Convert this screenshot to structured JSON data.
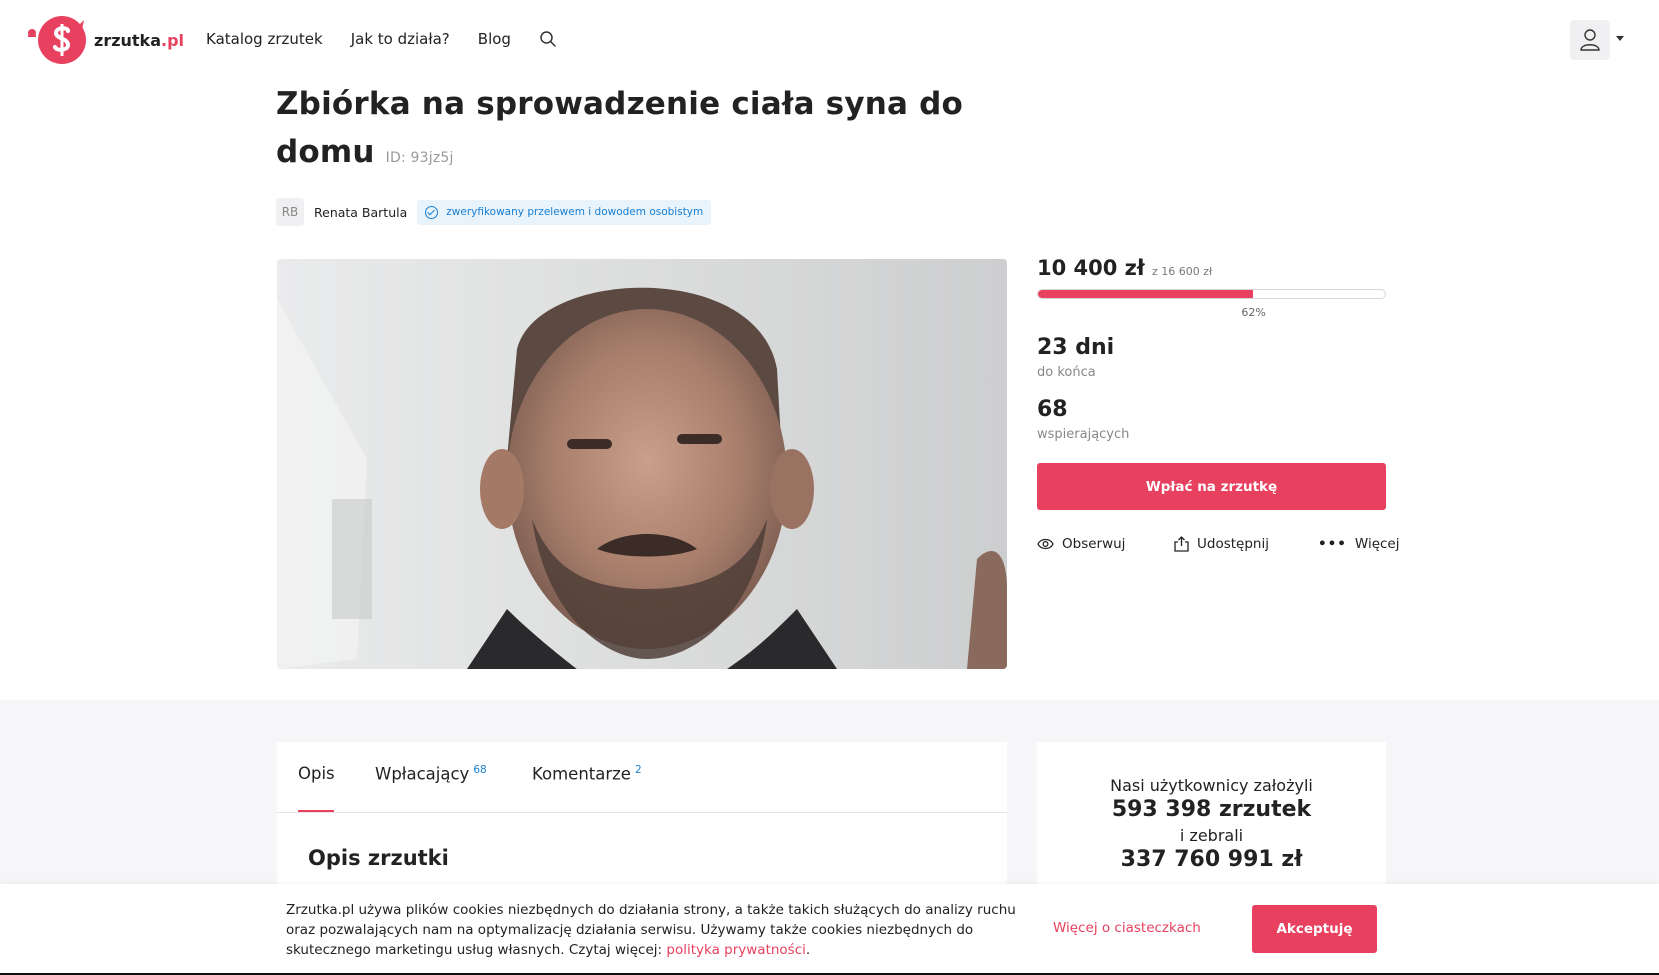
{
  "header": {
    "logo_text": "zrzutka",
    "logo_tld": ".pl",
    "nav": [
      "Katalog zrzutek",
      "Jak to działa?",
      "Blog"
    ],
    "icons": {
      "search": "search-icon",
      "user": "user-icon",
      "caret": "chevron-down-icon"
    }
  },
  "campaign": {
    "title": "Zbiórka na sprowadzenie ciała syna do domu",
    "id_label": "ID: 93jz5j",
    "author_initials": "RB",
    "author_name": "Renata Bartula",
    "verified_text": "zweryfikowany przelewem i dowodem osobistym"
  },
  "stats": {
    "raised": "10 400 zł",
    "goal": "z 16 600 zł",
    "progress_fraction": 0.62,
    "progress_label": "62%",
    "days": "23 dni",
    "days_label": "do końca",
    "supporters": "68",
    "supporters_label": "wspierających",
    "donate_label": "Wpłać na zrzutkę",
    "actions": {
      "observe": "Obserwuj",
      "share": "Udostępnij",
      "more": "Więcej"
    }
  },
  "tabs": [
    {
      "label": "Opis",
      "count": ""
    },
    {
      "label": "Wpłacający",
      "count": "68"
    },
    {
      "label": "Komentarze",
      "count": "2"
    }
  ],
  "description_title": "Opis zrzutki",
  "site_stats": {
    "line1": "Nasi użytkownicy założyli",
    "count": "593 398 zrzutek",
    "line2": "i zebrali",
    "sum": "337 760 991 zł"
  },
  "cookie": {
    "text": "Zrzutka.pl używa plików cookies niezbędnych do działania strony, a także takich służących do analizy ruchu oraz pozwalających nam na optymalizację działania serwisu. Używamy także cookies niezbędnych do skutecznego marketingu usług własnych. Czytaj więcej:",
    "link": "polityka prywatności",
    "after_link": ".",
    "more": "Więcej o ciasteczkach",
    "accept": "Akceptuję"
  },
  "colors": {
    "accent": "#e8415f",
    "blue": "#1a7fd1"
  }
}
